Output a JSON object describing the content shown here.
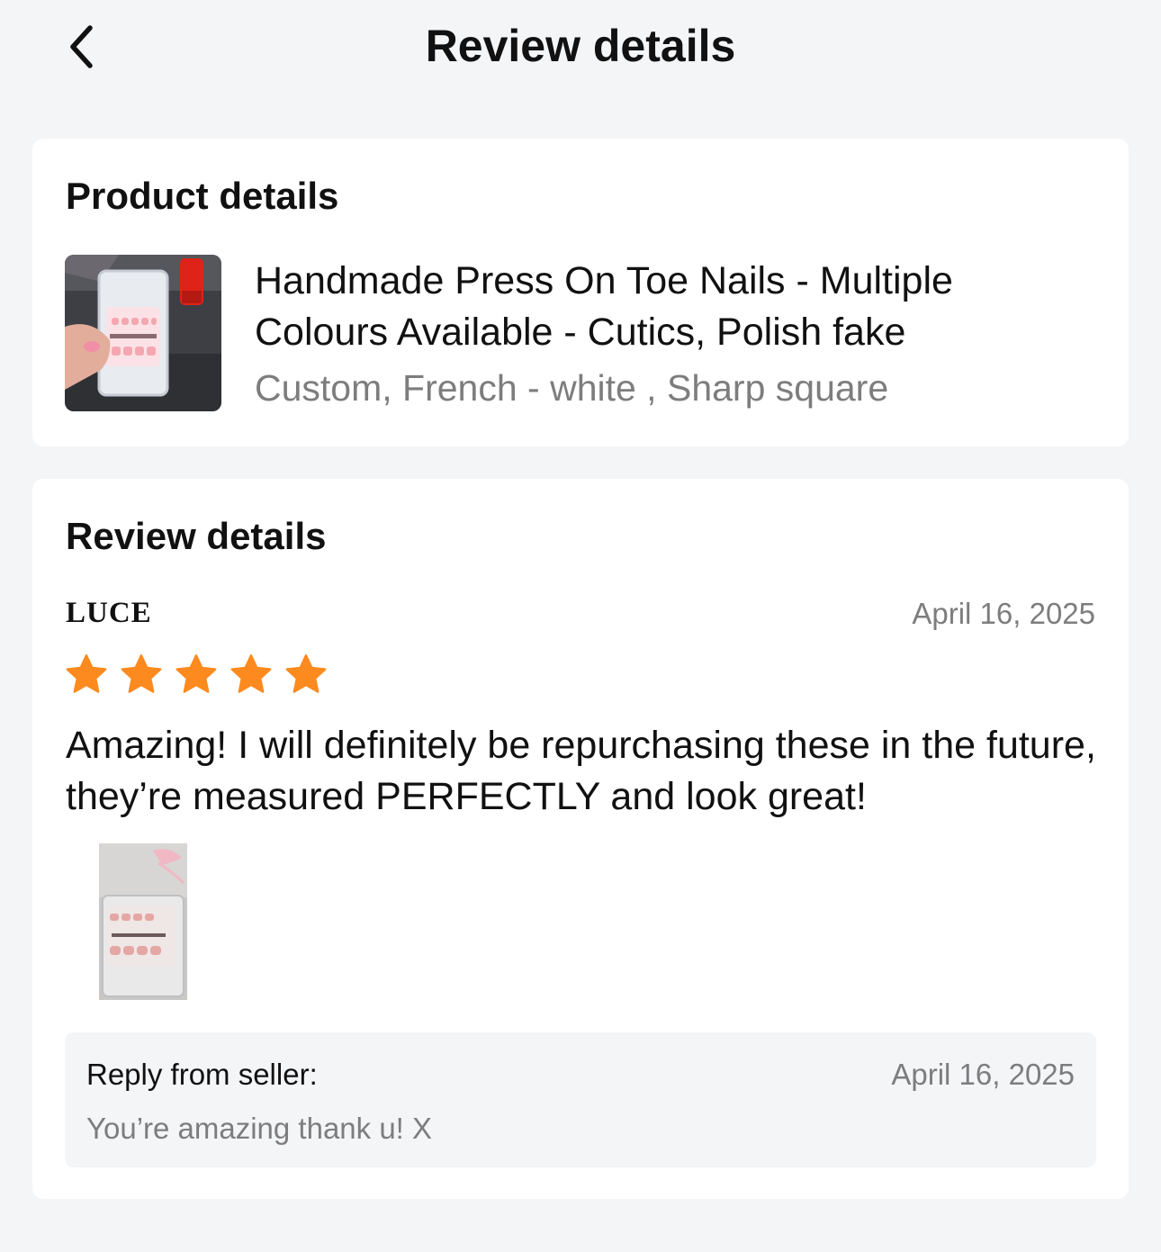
{
  "header": {
    "title": "Review details",
    "back_icon": "chevron-left-icon"
  },
  "product_section": {
    "title": "Product details",
    "product": {
      "name": "Handmade Press On Toe Nails - Multiple Colours Available - Cutics, Polish fake",
      "variant": "Custom, French - white , Sharp square"
    }
  },
  "review_section": {
    "title": "Review details",
    "reviewer": "LUCE",
    "date": "April 16, 2025",
    "rating": 5,
    "rating_max": 5,
    "text": "Amazing! I will definitely be repurchasing these in the future, they’re measured PERFECTLY and look great!",
    "photo_count": 1,
    "reply": {
      "label": "Reply from seller:",
      "date": "April 16, 2025",
      "text": "You’re amazing thank u! X"
    }
  },
  "colors": {
    "background": "#f4f5f7",
    "card": "#ffffff",
    "star": "#fd8a1e",
    "muted_text": "#7d7d7d"
  }
}
